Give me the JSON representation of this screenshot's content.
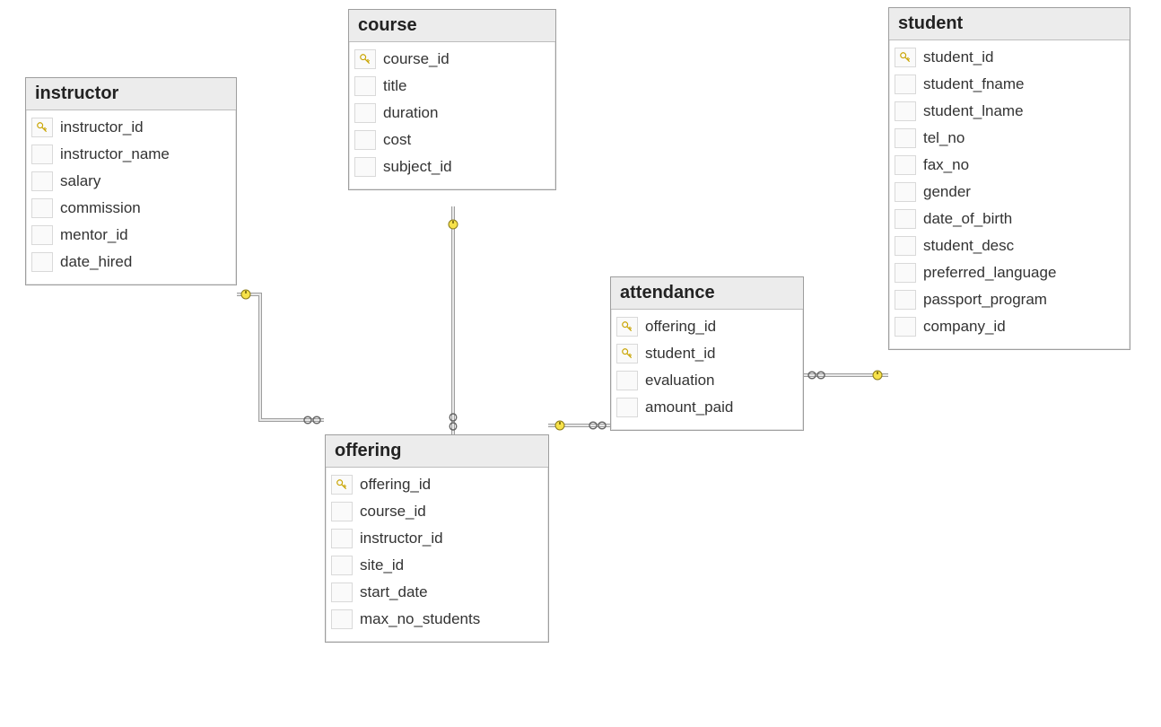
{
  "entities": {
    "instructor": {
      "title": "instructor",
      "fields": [
        {
          "name": "instructor_id",
          "pk": true
        },
        {
          "name": "instructor_name",
          "pk": false
        },
        {
          "name": "salary",
          "pk": false
        },
        {
          "name": "commission",
          "pk": false
        },
        {
          "name": "mentor_id",
          "pk": false
        },
        {
          "name": "date_hired",
          "pk": false
        }
      ]
    },
    "course": {
      "title": "course",
      "fields": [
        {
          "name": "course_id",
          "pk": true
        },
        {
          "name": "title",
          "pk": false
        },
        {
          "name": "duration",
          "pk": false
        },
        {
          "name": "cost",
          "pk": false
        },
        {
          "name": "subject_id",
          "pk": false
        }
      ]
    },
    "student": {
      "title": "student",
      "fields": [
        {
          "name": "student_id",
          "pk": true
        },
        {
          "name": "student_fname",
          "pk": false
        },
        {
          "name": "student_lname",
          "pk": false
        },
        {
          "name": "tel_no",
          "pk": false
        },
        {
          "name": "fax_no",
          "pk": false
        },
        {
          "name": "gender",
          "pk": false
        },
        {
          "name": "date_of_birth",
          "pk": false
        },
        {
          "name": "student_desc",
          "pk": false
        },
        {
          "name": "preferred_language",
          "pk": false
        },
        {
          "name": "passport_program",
          "pk": false
        },
        {
          "name": "company_id",
          "pk": false
        }
      ]
    },
    "attendance": {
      "title": "attendance",
      "fields": [
        {
          "name": "offering_id",
          "pk": true
        },
        {
          "name": "student_id",
          "pk": true
        },
        {
          "name": "evaluation",
          "pk": false
        },
        {
          "name": "amount_paid",
          "pk": false
        }
      ]
    },
    "offering": {
      "title": "offering",
      "fields": [
        {
          "name": "offering_id",
          "pk": true
        },
        {
          "name": "course_id",
          "pk": false
        },
        {
          "name": "instructor_id",
          "pk": false
        },
        {
          "name": "site_id",
          "pk": false
        },
        {
          "name": "start_date",
          "pk": false
        },
        {
          "name": "max_no_students",
          "pk": false
        }
      ]
    }
  },
  "relationships": [
    {
      "from": "instructor",
      "to": "offering",
      "type": "one-to-many"
    },
    {
      "from": "course",
      "to": "offering",
      "type": "one-to-many"
    },
    {
      "from": "offering",
      "to": "attendance",
      "type": "one-to-many"
    },
    {
      "from": "student",
      "to": "attendance",
      "type": "one-to-many"
    }
  ]
}
